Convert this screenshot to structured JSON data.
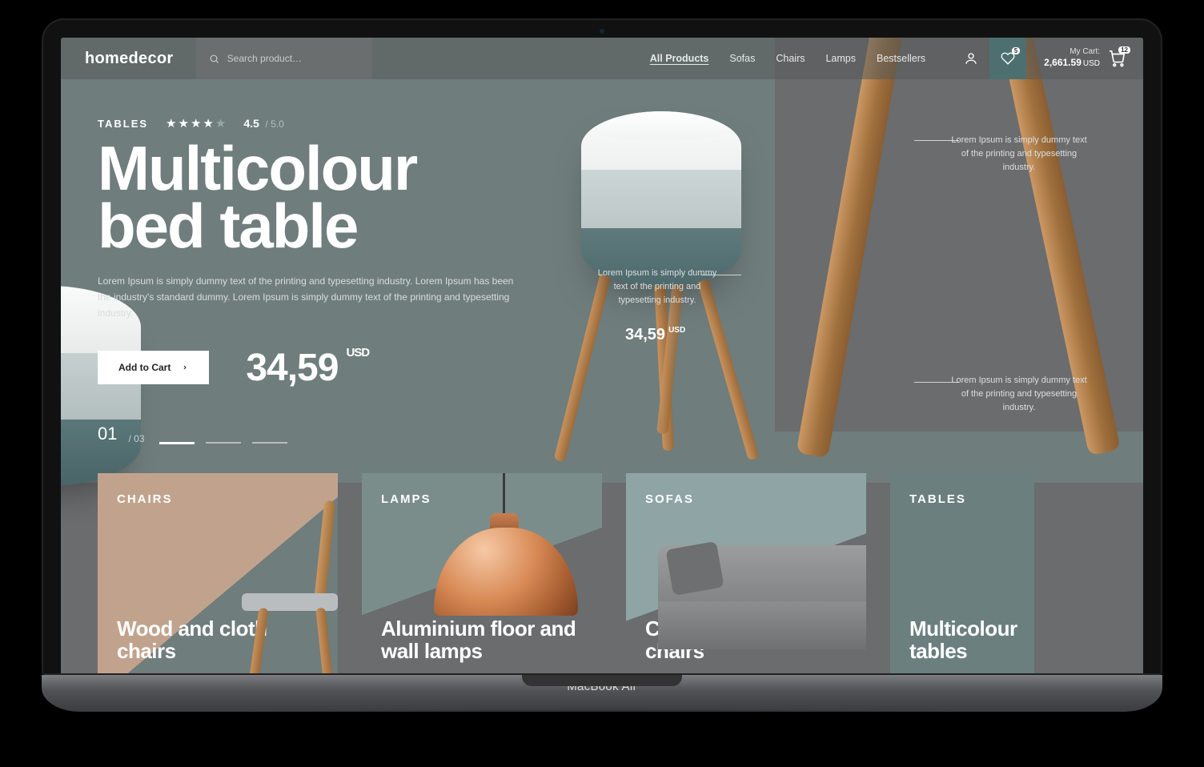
{
  "brand": "homedecor",
  "search": {
    "placeholder": "Search product…"
  },
  "nav": {
    "items": [
      "All Products",
      "Sofas",
      "Chairs",
      "Lamps",
      "Bestsellers"
    ],
    "activeIndex": 0
  },
  "header": {
    "wishlist_badge": "5",
    "cart_label": "My Cart:",
    "cart_amount": "2,661.59",
    "cart_currency": "USD",
    "cart_badge": "12"
  },
  "hero": {
    "category": "TABLES",
    "rating_value": "4.5",
    "rating_of": "/ 5.0",
    "title_line1": "Multicolour",
    "title_line2": "bed table",
    "description": "Lorem Ipsum is simply dummy text of the printing and typesetting industry. Lorem Ipsum has been the industry's standard dummy. Lorem Ipsum is simply dummy text of the printing and typesetting industry.",
    "cta": "Add to Cart",
    "price": "34,59",
    "currency": "USD",
    "page_current": "01",
    "page_total": "/ 03"
  },
  "callout_text": "Lorem Ipsum is simply dummy text of the printing and typesetting industry.",
  "mini_price": {
    "value": "34,59",
    "currency": "USD"
  },
  "cards": [
    {
      "category": "CHAIRS",
      "title": "Wood and cloth chairs"
    },
    {
      "category": "LAMPS",
      "title": "Aluminium floor and wall lamps"
    },
    {
      "category": "SOFAS",
      "title": "Cloth sofas and chairs"
    },
    {
      "category": "TABLES",
      "title": "Multicolour tables"
    }
  ],
  "device_label": "MacBook Air"
}
